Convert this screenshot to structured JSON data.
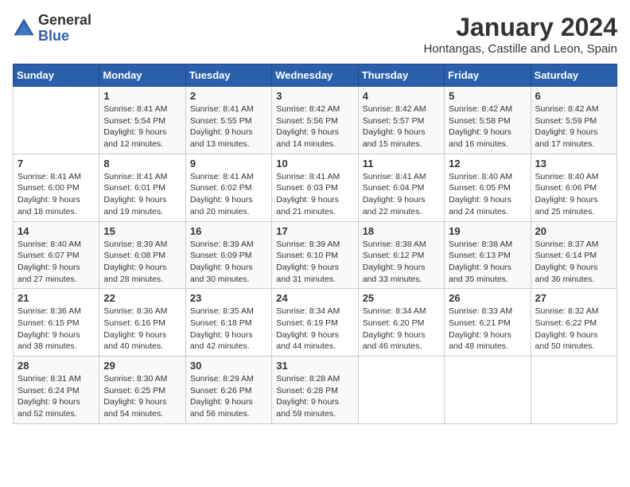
{
  "header": {
    "logo_general": "General",
    "logo_blue": "Blue",
    "main_title": "January 2024",
    "subtitle": "Hontangas, Castille and Leon, Spain"
  },
  "calendar": {
    "weekdays": [
      "Sunday",
      "Monday",
      "Tuesday",
      "Wednesday",
      "Thursday",
      "Friday",
      "Saturday"
    ],
    "weeks": [
      [
        {
          "day": "",
          "info": ""
        },
        {
          "day": "1",
          "info": "Sunrise: 8:41 AM\nSunset: 5:54 PM\nDaylight: 9 hours\nand 12 minutes."
        },
        {
          "day": "2",
          "info": "Sunrise: 8:41 AM\nSunset: 5:55 PM\nDaylight: 9 hours\nand 13 minutes."
        },
        {
          "day": "3",
          "info": "Sunrise: 8:42 AM\nSunset: 5:56 PM\nDaylight: 9 hours\nand 14 minutes."
        },
        {
          "day": "4",
          "info": "Sunrise: 8:42 AM\nSunset: 5:57 PM\nDaylight: 9 hours\nand 15 minutes."
        },
        {
          "day": "5",
          "info": "Sunrise: 8:42 AM\nSunset: 5:58 PM\nDaylight: 9 hours\nand 16 minutes."
        },
        {
          "day": "6",
          "info": "Sunrise: 8:42 AM\nSunset: 5:59 PM\nDaylight: 9 hours\nand 17 minutes."
        }
      ],
      [
        {
          "day": "7",
          "info": "Sunrise: 8:41 AM\nSunset: 6:00 PM\nDaylight: 9 hours\nand 18 minutes."
        },
        {
          "day": "8",
          "info": "Sunrise: 8:41 AM\nSunset: 6:01 PM\nDaylight: 9 hours\nand 19 minutes."
        },
        {
          "day": "9",
          "info": "Sunrise: 8:41 AM\nSunset: 6:02 PM\nDaylight: 9 hours\nand 20 minutes."
        },
        {
          "day": "10",
          "info": "Sunrise: 8:41 AM\nSunset: 6:03 PM\nDaylight: 9 hours\nand 21 minutes."
        },
        {
          "day": "11",
          "info": "Sunrise: 8:41 AM\nSunset: 6:04 PM\nDaylight: 9 hours\nand 22 minutes."
        },
        {
          "day": "12",
          "info": "Sunrise: 8:40 AM\nSunset: 6:05 PM\nDaylight: 9 hours\nand 24 minutes."
        },
        {
          "day": "13",
          "info": "Sunrise: 8:40 AM\nSunset: 6:06 PM\nDaylight: 9 hours\nand 25 minutes."
        }
      ],
      [
        {
          "day": "14",
          "info": "Sunrise: 8:40 AM\nSunset: 6:07 PM\nDaylight: 9 hours\nand 27 minutes."
        },
        {
          "day": "15",
          "info": "Sunrise: 8:39 AM\nSunset: 6:08 PM\nDaylight: 9 hours\nand 28 minutes."
        },
        {
          "day": "16",
          "info": "Sunrise: 8:39 AM\nSunset: 6:09 PM\nDaylight: 9 hours\nand 30 minutes."
        },
        {
          "day": "17",
          "info": "Sunrise: 8:39 AM\nSunset: 6:10 PM\nDaylight: 9 hours\nand 31 minutes."
        },
        {
          "day": "18",
          "info": "Sunrise: 8:38 AM\nSunset: 6:12 PM\nDaylight: 9 hours\nand 33 minutes."
        },
        {
          "day": "19",
          "info": "Sunrise: 8:38 AM\nSunset: 6:13 PM\nDaylight: 9 hours\nand 35 minutes."
        },
        {
          "day": "20",
          "info": "Sunrise: 8:37 AM\nSunset: 6:14 PM\nDaylight: 9 hours\nand 36 minutes."
        }
      ],
      [
        {
          "day": "21",
          "info": "Sunrise: 8:36 AM\nSunset: 6:15 PM\nDaylight: 9 hours\nand 38 minutes."
        },
        {
          "day": "22",
          "info": "Sunrise: 8:36 AM\nSunset: 6:16 PM\nDaylight: 9 hours\nand 40 minutes."
        },
        {
          "day": "23",
          "info": "Sunrise: 8:35 AM\nSunset: 6:18 PM\nDaylight: 9 hours\nand 42 minutes."
        },
        {
          "day": "24",
          "info": "Sunrise: 8:34 AM\nSunset: 6:19 PM\nDaylight: 9 hours\nand 44 minutes."
        },
        {
          "day": "25",
          "info": "Sunrise: 8:34 AM\nSunset: 6:20 PM\nDaylight: 9 hours\nand 46 minutes."
        },
        {
          "day": "26",
          "info": "Sunrise: 8:33 AM\nSunset: 6:21 PM\nDaylight: 9 hours\nand 48 minutes."
        },
        {
          "day": "27",
          "info": "Sunrise: 8:32 AM\nSunset: 6:22 PM\nDaylight: 9 hours\nand 50 minutes."
        }
      ],
      [
        {
          "day": "28",
          "info": "Sunrise: 8:31 AM\nSunset: 6:24 PM\nDaylight: 9 hours\nand 52 minutes."
        },
        {
          "day": "29",
          "info": "Sunrise: 8:30 AM\nSunset: 6:25 PM\nDaylight: 9 hours\nand 54 minutes."
        },
        {
          "day": "30",
          "info": "Sunrise: 8:29 AM\nSunset: 6:26 PM\nDaylight: 9 hours\nand 56 minutes."
        },
        {
          "day": "31",
          "info": "Sunrise: 8:28 AM\nSunset: 6:28 PM\nDaylight: 9 hours\nand 59 minutes."
        },
        {
          "day": "",
          "info": ""
        },
        {
          "day": "",
          "info": ""
        },
        {
          "day": "",
          "info": ""
        }
      ]
    ]
  }
}
